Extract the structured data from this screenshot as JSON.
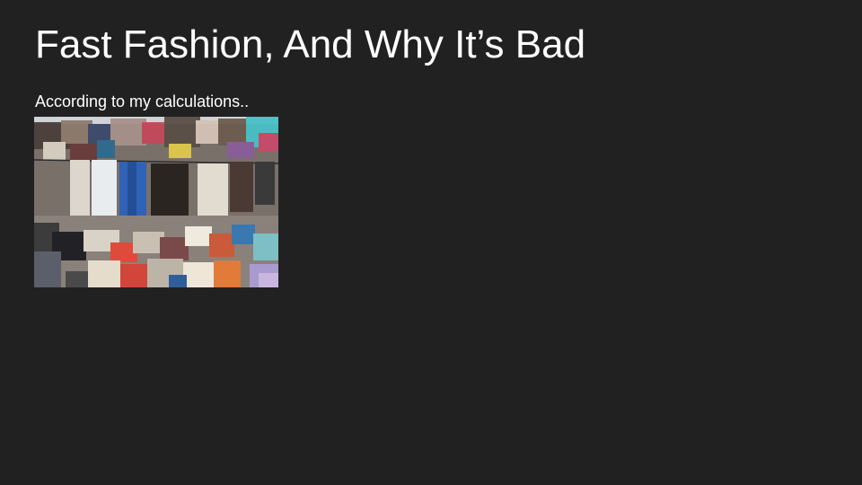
{
  "slide": {
    "title": "Fast Fashion, And Why It’s Bad",
    "body_text": "According to my calculations..",
    "image": {
      "alt": "clothing waste landfill photo",
      "colors": {
        "background": "#212121",
        "text": "#ffffff"
      }
    }
  }
}
